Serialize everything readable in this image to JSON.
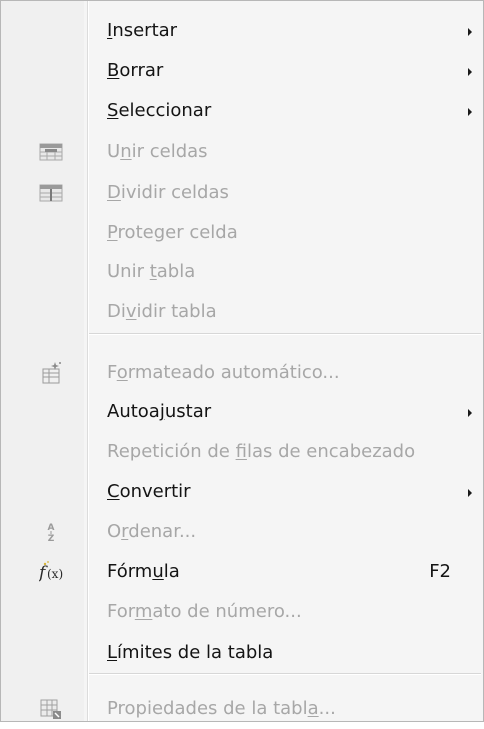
{
  "menu": {
    "items": [
      {
        "label": "Insertar",
        "mnemonic": 0,
        "enabled": true,
        "submenu": true,
        "icon": ""
      },
      {
        "label": "Borrar",
        "mnemonic": 0,
        "enabled": true,
        "submenu": true,
        "icon": ""
      },
      {
        "label": "Seleccionar",
        "mnemonic": 0,
        "enabled": true,
        "submenu": true,
        "icon": ""
      },
      {
        "label": "Unir celdas",
        "mnemonic": 1,
        "enabled": false,
        "submenu": false,
        "icon": "merge-cells-icon"
      },
      {
        "label": "Dividir celdas",
        "mnemonic": 0,
        "enabled": false,
        "submenu": false,
        "icon": "split-cells-icon"
      },
      {
        "label": "Proteger celda",
        "mnemonic": 0,
        "enabled": false,
        "submenu": false,
        "icon": ""
      },
      {
        "label": "Unir tabla",
        "mnemonic": 5,
        "enabled": false,
        "submenu": false,
        "icon": ""
      },
      {
        "label": "Dividir tabla",
        "mnemonic": 2,
        "enabled": false,
        "submenu": false,
        "icon": ""
      },
      {
        "separator": true
      },
      {
        "label": "Formateado automático...",
        "mnemonic": 1,
        "enabled": false,
        "submenu": false,
        "icon": "autoformat-icon"
      },
      {
        "label": "Autoajustar",
        "mnemonic": 5,
        "enabled": true,
        "submenu": true,
        "icon": ""
      },
      {
        "label": "Repetición de filas de encabezado",
        "mnemonic": 14,
        "enabled": false,
        "submenu": false,
        "icon": ""
      },
      {
        "label": "Convertir",
        "mnemonic": 0,
        "enabled": true,
        "submenu": true,
        "icon": ""
      },
      {
        "label": "Ordenar...",
        "mnemonic": 1,
        "enabled": false,
        "submenu": false,
        "icon": "sort-icon"
      },
      {
        "label": "Fórmula",
        "mnemonic": 4,
        "enabled": true,
        "submenu": false,
        "icon": "formula-icon",
        "shortcut": "F2"
      },
      {
        "label": "Formato de número...",
        "mnemonic": 3,
        "enabled": false,
        "submenu": false,
        "icon": ""
      },
      {
        "label": "Límites de la tabla",
        "mnemonic": 0,
        "enabled": true,
        "submenu": false,
        "icon": ""
      },
      {
        "separator": true
      },
      {
        "label": "Propiedades de la tabla...",
        "mnemonic": 22,
        "enabled": false,
        "submenu": false,
        "icon": "table-properties-icon"
      }
    ]
  },
  "colors": {
    "enabled_text": "#141414",
    "disabled_text": "#a7a7a7",
    "menu_bg": "#f5f5f5"
  }
}
